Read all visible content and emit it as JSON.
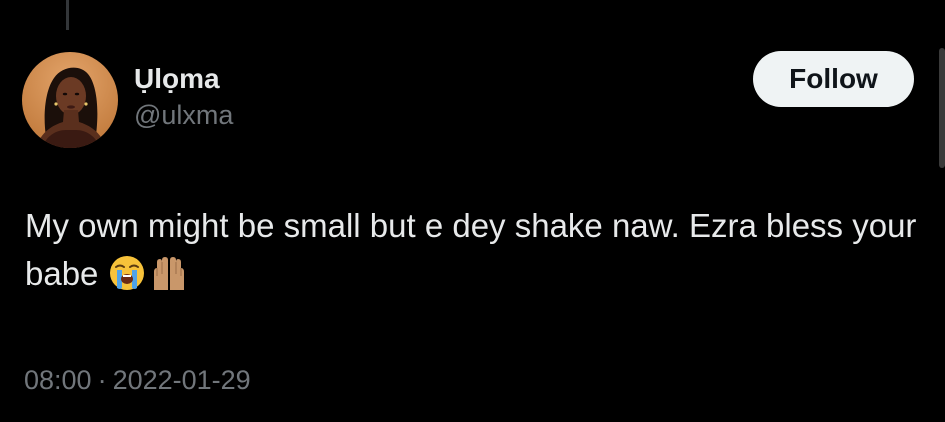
{
  "tweet": {
    "author": {
      "display_name": "Ụlọma",
      "handle": "@ulxma",
      "avatar_icon": "profile-photo"
    },
    "follow_label": "Follow",
    "text_main": "My own might be small but e dey shake naw. Ezra bless your babe",
    "emojis": [
      "loudly-crying-face-icon",
      "raising-hands-medium-skin-icon"
    ],
    "time": "08:00",
    "separator": "·",
    "date": "2022-01-29"
  },
  "colors": {
    "background": "#000000",
    "primary_text": "#e7e9ea",
    "secondary_text": "#71767b",
    "button_bg": "#eff3f4",
    "button_text": "#0f1419"
  }
}
